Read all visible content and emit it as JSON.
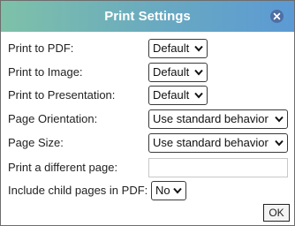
{
  "dialog": {
    "title": "Print Settings",
    "ok_label": "OK"
  },
  "fields": {
    "print_pdf": {
      "label": "Print to PDF:",
      "value": "Default"
    },
    "print_image": {
      "label": "Print to Image:",
      "value": "Default"
    },
    "print_presentation": {
      "label": "Print to Presentation:",
      "value": "Default"
    },
    "page_orientation": {
      "label": "Page Orientation:",
      "value": "Use standard behavior"
    },
    "page_size": {
      "label": "Page Size:",
      "value": "Use standard behavior"
    },
    "different_page": {
      "label": "Print a different page:",
      "value": ""
    },
    "child_pages": {
      "label": "Include child pages in PDF:",
      "value": "No"
    }
  },
  "icons": {
    "close": "close-icon",
    "dropdown": "chevron-down-icon"
  },
  "colors": {
    "title_gradient_start": "#7ec1a8",
    "title_gradient_end": "#5b9ad4",
    "close_button": "#4f6ea3"
  }
}
